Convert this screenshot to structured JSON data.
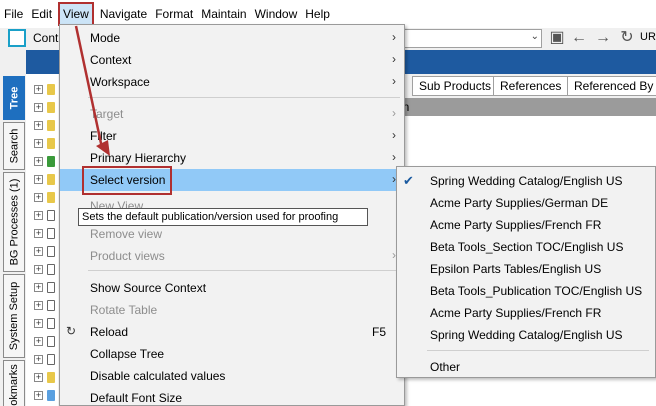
{
  "menubar": {
    "items": [
      "File",
      "Edit",
      "View",
      "Navigate",
      "Format",
      "Maintain",
      "Window",
      "Help"
    ],
    "active": "View"
  },
  "toolbar": {
    "context_label": "Cont",
    "url_label": "URI"
  },
  "left_tabs": [
    "Tree",
    "Search",
    "BG Processes (1)",
    "System Setup",
    "okmarks"
  ],
  "right_tabs": [
    "Sub Products",
    "References",
    "Referenced By"
  ],
  "column_header": "on",
  "view_menu": {
    "items": [
      {
        "label": "Mode",
        "submenu": true,
        "disabled": false
      },
      {
        "label": "Context",
        "submenu": true,
        "disabled": false
      },
      {
        "label": "Workspace",
        "submenu": true,
        "disabled": false
      },
      {
        "label": "Target",
        "submenu": true,
        "disabled": true
      },
      {
        "label": "Filter",
        "submenu": true,
        "disabled": false
      },
      {
        "label": "Primary Hierarchy",
        "submenu": true,
        "disabled": false
      },
      {
        "label": "Select version",
        "submenu": true,
        "disabled": false,
        "highlighted": true
      },
      {
        "label": "New View",
        "submenu": false,
        "disabled": true
      },
      {
        "label": "Remove view",
        "submenu": false,
        "disabled": true
      },
      {
        "label": "Product views",
        "submenu": true,
        "disabled": true
      },
      {
        "label": "Show Source Context",
        "submenu": false,
        "disabled": false
      },
      {
        "label": "Rotate Table",
        "submenu": false,
        "disabled": true
      },
      {
        "label": "Reload",
        "submenu": false,
        "disabled": false,
        "shortcut": "F5",
        "icon": "reload-icon"
      },
      {
        "label": "Collapse Tree",
        "submenu": false,
        "disabled": false
      },
      {
        "label": "Disable calculated values",
        "submenu": false,
        "disabled": false
      },
      {
        "label": "Default Font Size",
        "submenu": false,
        "disabled": false
      }
    ]
  },
  "tooltip": "Sets the default publication/version used for proofing",
  "version_submenu": {
    "items": [
      {
        "label": "Spring Wedding Catalog/English US",
        "checked": true
      },
      {
        "label": "Acme Party Supplies/German DE",
        "checked": false
      },
      {
        "label": "Acme Party Supplies/French FR",
        "checked": false
      },
      {
        "label": "Beta Tools_Section TOC/English US",
        "checked": false
      },
      {
        "label": "Epsilon Parts Tables/English US",
        "checked": false
      },
      {
        "label": "Beta Tools_Publication TOC/English US",
        "checked": false
      },
      {
        "label": "Acme Party Supplies/French FR",
        "checked": false
      },
      {
        "label": "Spring Wedding Catalog/English US",
        "checked": false
      },
      {
        "label": "Other",
        "checked": false
      }
    ]
  },
  "colors": {
    "highlight": "#91c9f7",
    "annotation": "#b03030",
    "header_band": "#1e5aa0",
    "tree_tab": "#1e6fbf"
  }
}
